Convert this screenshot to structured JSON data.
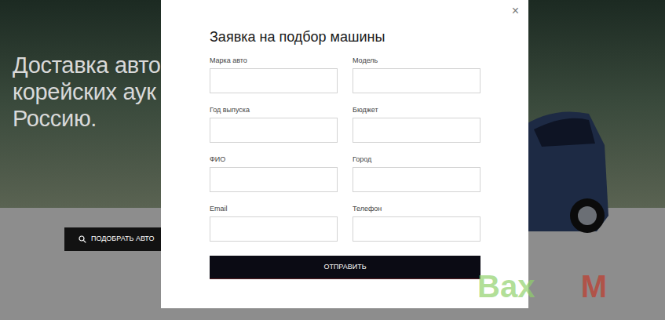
{
  "hero": {
    "lines": [
      "Доставка авто",
      "корейских аук",
      "Россию."
    ],
    "button": {
      "label": "ПОДОБРАТЬ АВТО"
    }
  },
  "modal": {
    "title": "Заявка на подбор машины",
    "close": "×",
    "fields": [
      {
        "label": "Марка авто"
      },
      {
        "label": "Модель"
      },
      {
        "label": "Год выпуска"
      },
      {
        "label": "Бюджет"
      },
      {
        "label": "ФИО"
      },
      {
        "label": "Город"
      },
      {
        "label": "Email"
      },
      {
        "label": "Телефон"
      }
    ],
    "submit": "ОТПРАВИТЬ"
  },
  "watermark": [
    "Bax",
    "M"
  ]
}
